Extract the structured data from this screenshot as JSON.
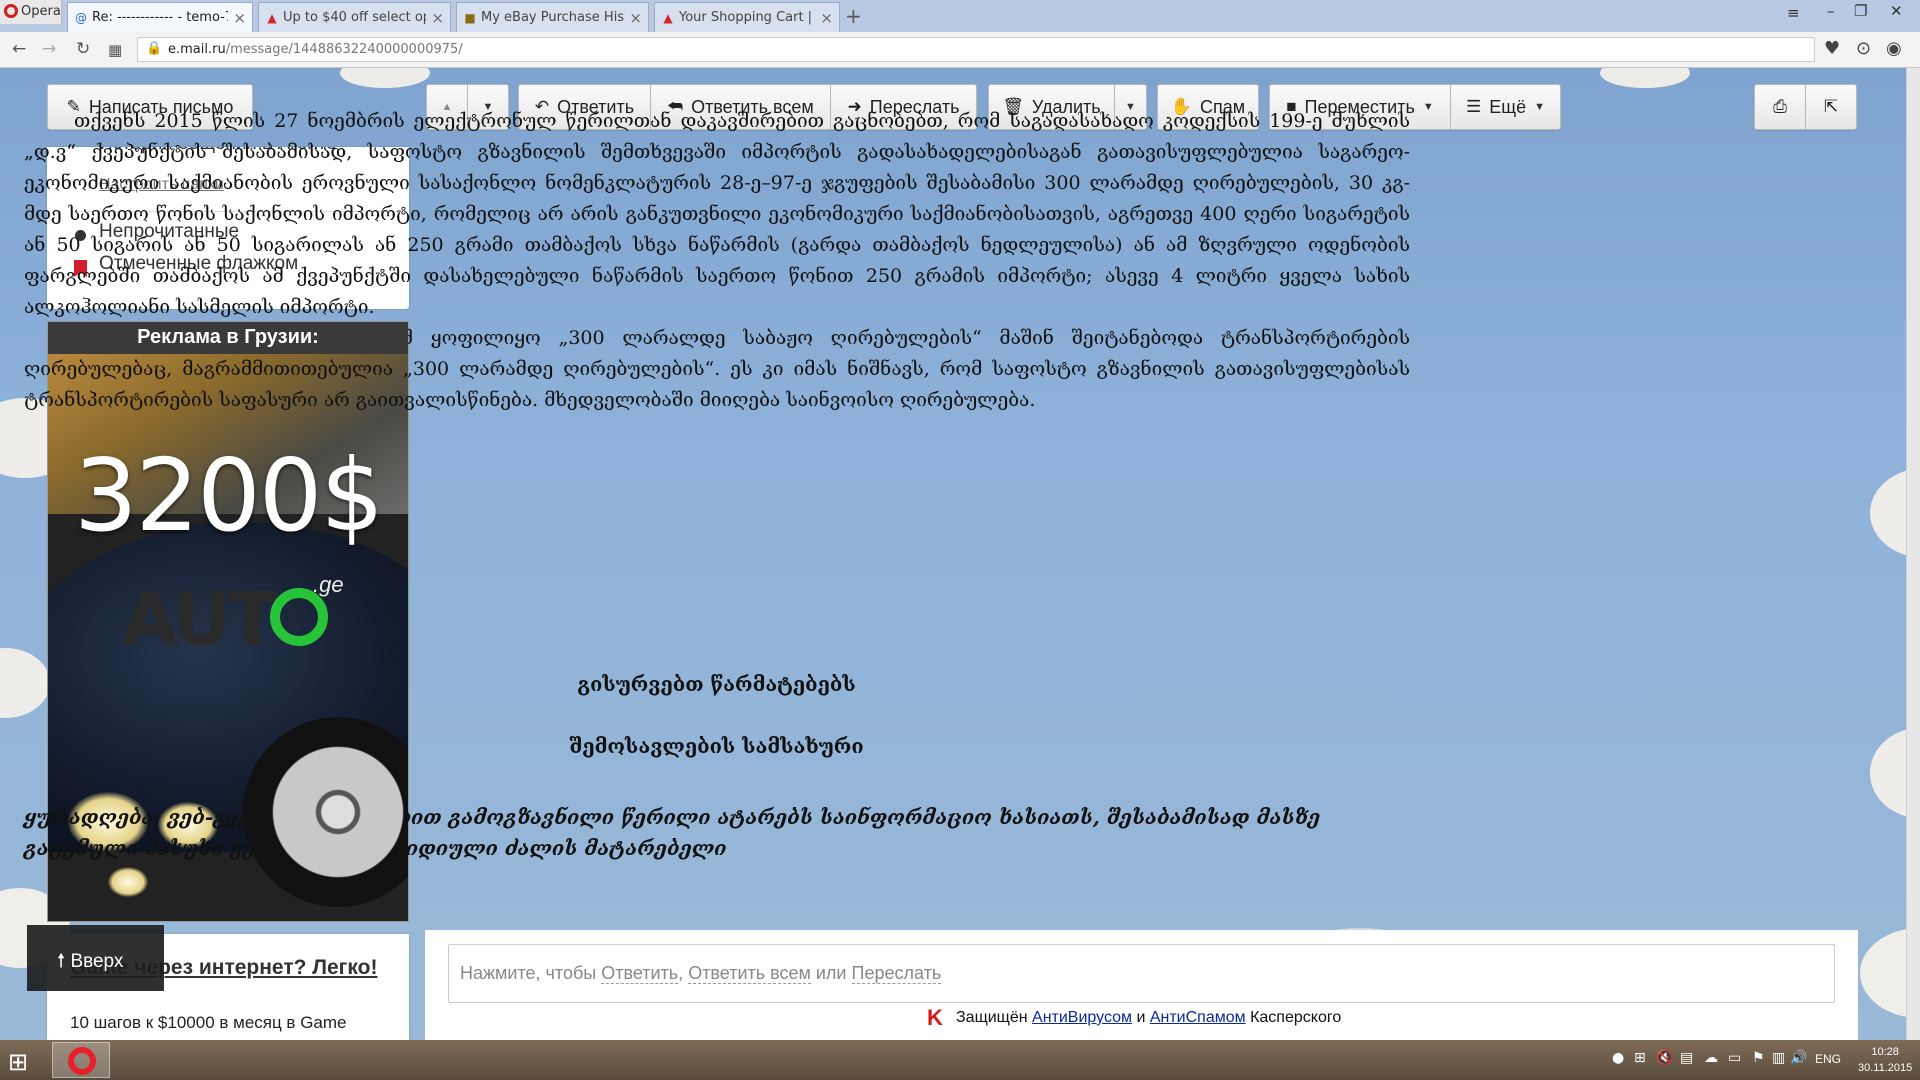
{
  "browser": {
    "menu_label": "Opera",
    "tabs": [
      {
        "title": "Re: ------------ - temo-777",
        "active": true
      },
      {
        "title": "Up to $40 off select optic",
        "active": false
      },
      {
        "title": "My eBay Purchase History",
        "active": false
      },
      {
        "title": "Your Shopping Cart | Pyra",
        "active": false
      }
    ],
    "url_host": "e.mail.ru",
    "url_path": "/message/14488632240000000975/"
  },
  "toolbar": {
    "compose": "Написать письмо",
    "reply": "Ответить",
    "reply_all": "Ответить всем",
    "forward": "Переслать",
    "delete": "Удалить",
    "spam": "Спам",
    "move": "Переместить",
    "more": "Ещё"
  },
  "sidebar": {
    "history": "История общения в Агенте",
    "configure_folders": "Настроить папки",
    "unread": "Непрочитанные",
    "flagged": "Отмеченные флажком"
  },
  "ad": {
    "title": "Реклама в Грузии:",
    "price": "3200$",
    "logo_text": "AUT",
    "logo_suffix": ".ge"
  },
  "ad2": {
    "title": "Game через интернет? Легко!",
    "desc": "10 шагов к $10000 в месяц в Game"
  },
  "scroll_top": "Вверх",
  "message": {
    "paragraph1": "თქვენს 2015 წლის 27 ნოემბრის ელექტრონულ წერილთან დაკავშირებით გაცნობებთ, რომ საგადასახადო კოდექსის 199-ე მუხლის „დ.ვ“ ქვეპუნქტის შესაბამისად, საფოსტო გზავნილის შემთხვევაში იმპორტის გადასახადელებისაგან გათავისუფლებულია საგარეო-ეკონომიკური საქმიანობის ეროვნული სასაქონლო ნომენკლატურის 28-ე–97-ე ჯგუფების შესაბამისი 300 ლარამდე ღირებულების, 30 კგ-მდე საერთო წონის საქონლის იმპორტი, რომელიც არ არის განკუთვნილი ეკონომიკური საქმიანობისათვის, აგრეთვე 400 ღერი სიგარეტის ან 50 სიგარის ან 50 სიგარილას ან 250 გრამი თამბაქოს სხვა ნაწარმის (გარდა თამბაქოს ნედლეულისა) ან ამ ზღვრული ოდენობის ფარგლებში თამბაქოს ამ ქვეპუნქტში დასახელებული ნაწარმის საერთო წონით 250 გრამის იმპორტი; ასევე 4 ლიტრი ყველა სახის ალკოჰოლიანი სასმელის იმპორტი.",
    "paragraph2": "შესაბამისად, მითითებული რომ ყოფილიყო „300 ლარალდე საბაჟო ღირებულების“ მაშინ შეიტანებოდა ტრანსპორტირების ღირებულებაც, მაგრამმითითებულია „300 ლარამდე ღირებულების“. ეს კი იმას ნიშნავს, რომ საფოსტო გზავნილის გათავისუფლებისას ტრანსპორტირების საფასური არ გაითვალისწინება. მხედველობაში მიიღება საინვოისო ღირებულება.",
    "sign1": "გისურვებთ წარმატებებს",
    "sign2": "შემოსავლების სამსახური",
    "note": "ყურადღება: ვებ-გვერდის მეშვეობით გამოგზავნილი წერილი ატარებს საინფორმაციო ხასიათს, შესაბამისად მასზე გაცემული პასუხი ვერ იქნება იურიდიული ძალის მატარებელი"
  },
  "reply_prompt": {
    "prefix": "Нажмите, чтобы ",
    "reply": "Ответить",
    "comma": ", ",
    "reply_all": "Ответить всем",
    "or": " или ",
    "forward": "Переслать"
  },
  "kaspersky": {
    "protected": "Защищён ",
    "antivirus": "АнтиВирусом",
    "and": " и ",
    "antispam": "АнтиСпамом",
    "vendor": " Касперского"
  },
  "taskbar": {
    "lang": "ENG",
    "time": "10:28",
    "date": "30.11.2015"
  }
}
